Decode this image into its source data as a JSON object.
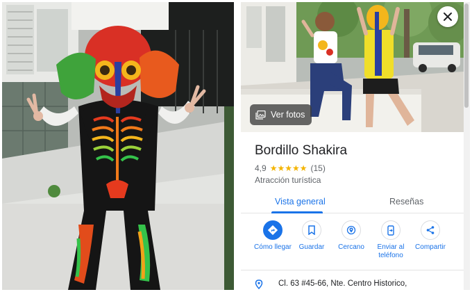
{
  "left_photo": {
    "description_icon": "costumed-person-photo"
  },
  "maps": {
    "hero": {
      "view_photos_label": "Ver fotos",
      "close_icon": "close-icon",
      "photos_icon": "photo-gallery-icon"
    },
    "place": {
      "title": "Bordillo Shakira",
      "rating": "4,9",
      "stars": "★★★★★",
      "review_count": "(15)",
      "category": "Atracción turística"
    },
    "tabs": [
      {
        "label": "Vista general",
        "active": true
      },
      {
        "label": "Reseñas",
        "active": false
      }
    ],
    "actions": [
      {
        "label": "Cómo llegar",
        "icon": "directions-icon"
      },
      {
        "label": "Guardar",
        "icon": "bookmark-icon"
      },
      {
        "label": "Cercano",
        "icon": "nearby-icon"
      },
      {
        "label": "Enviar al teléfono",
        "icon": "send-to-phone-icon"
      },
      {
        "label": "Compartir",
        "icon": "share-icon"
      }
    ],
    "address": {
      "icon": "location-pin-icon",
      "text": "Cl. 63 #45-66, Nte. Centro Historico,"
    }
  },
  "colors": {
    "accent": "#1a73e8",
    "star": "#f4b400",
    "text_primary": "#202124",
    "text_secondary": "#5f6368"
  }
}
